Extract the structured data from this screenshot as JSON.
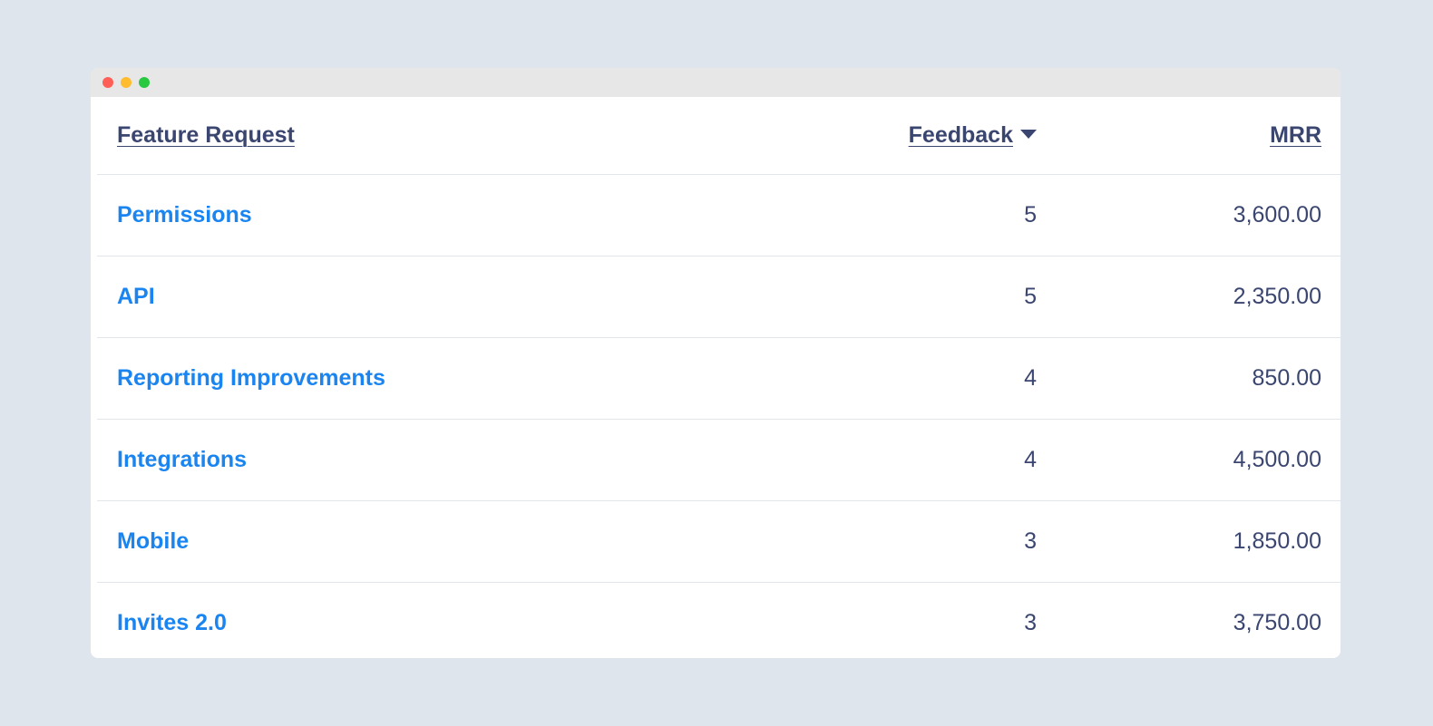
{
  "table": {
    "headers": {
      "name": "Feature Request",
      "feedback": "Feedback",
      "mrr": "MRR"
    },
    "sort": {
      "column": "feedback",
      "direction": "descending",
      "icon": "caret-down-icon"
    },
    "rows": [
      {
        "name": "Permissions",
        "feedback": "5",
        "mrr": "3,600.00"
      },
      {
        "name": "API",
        "feedback": "5",
        "mrr": "2,350.00"
      },
      {
        "name": "Reporting Improvements",
        "feedback": "4",
        "mrr": "850.00"
      },
      {
        "name": "Integrations",
        "feedback": "4",
        "mrr": "4,500.00"
      },
      {
        "name": "Mobile",
        "feedback": "3",
        "mrr": "1,850.00"
      },
      {
        "name": "Invites 2.0",
        "feedback": "3",
        "mrr": "3,750.00"
      }
    ]
  },
  "colors": {
    "link": "#1a85f0",
    "text": "#3a4670",
    "background": "#dfe5ec",
    "close": "#ff5f57",
    "minimize": "#febc2e",
    "maximize": "#28c840"
  }
}
